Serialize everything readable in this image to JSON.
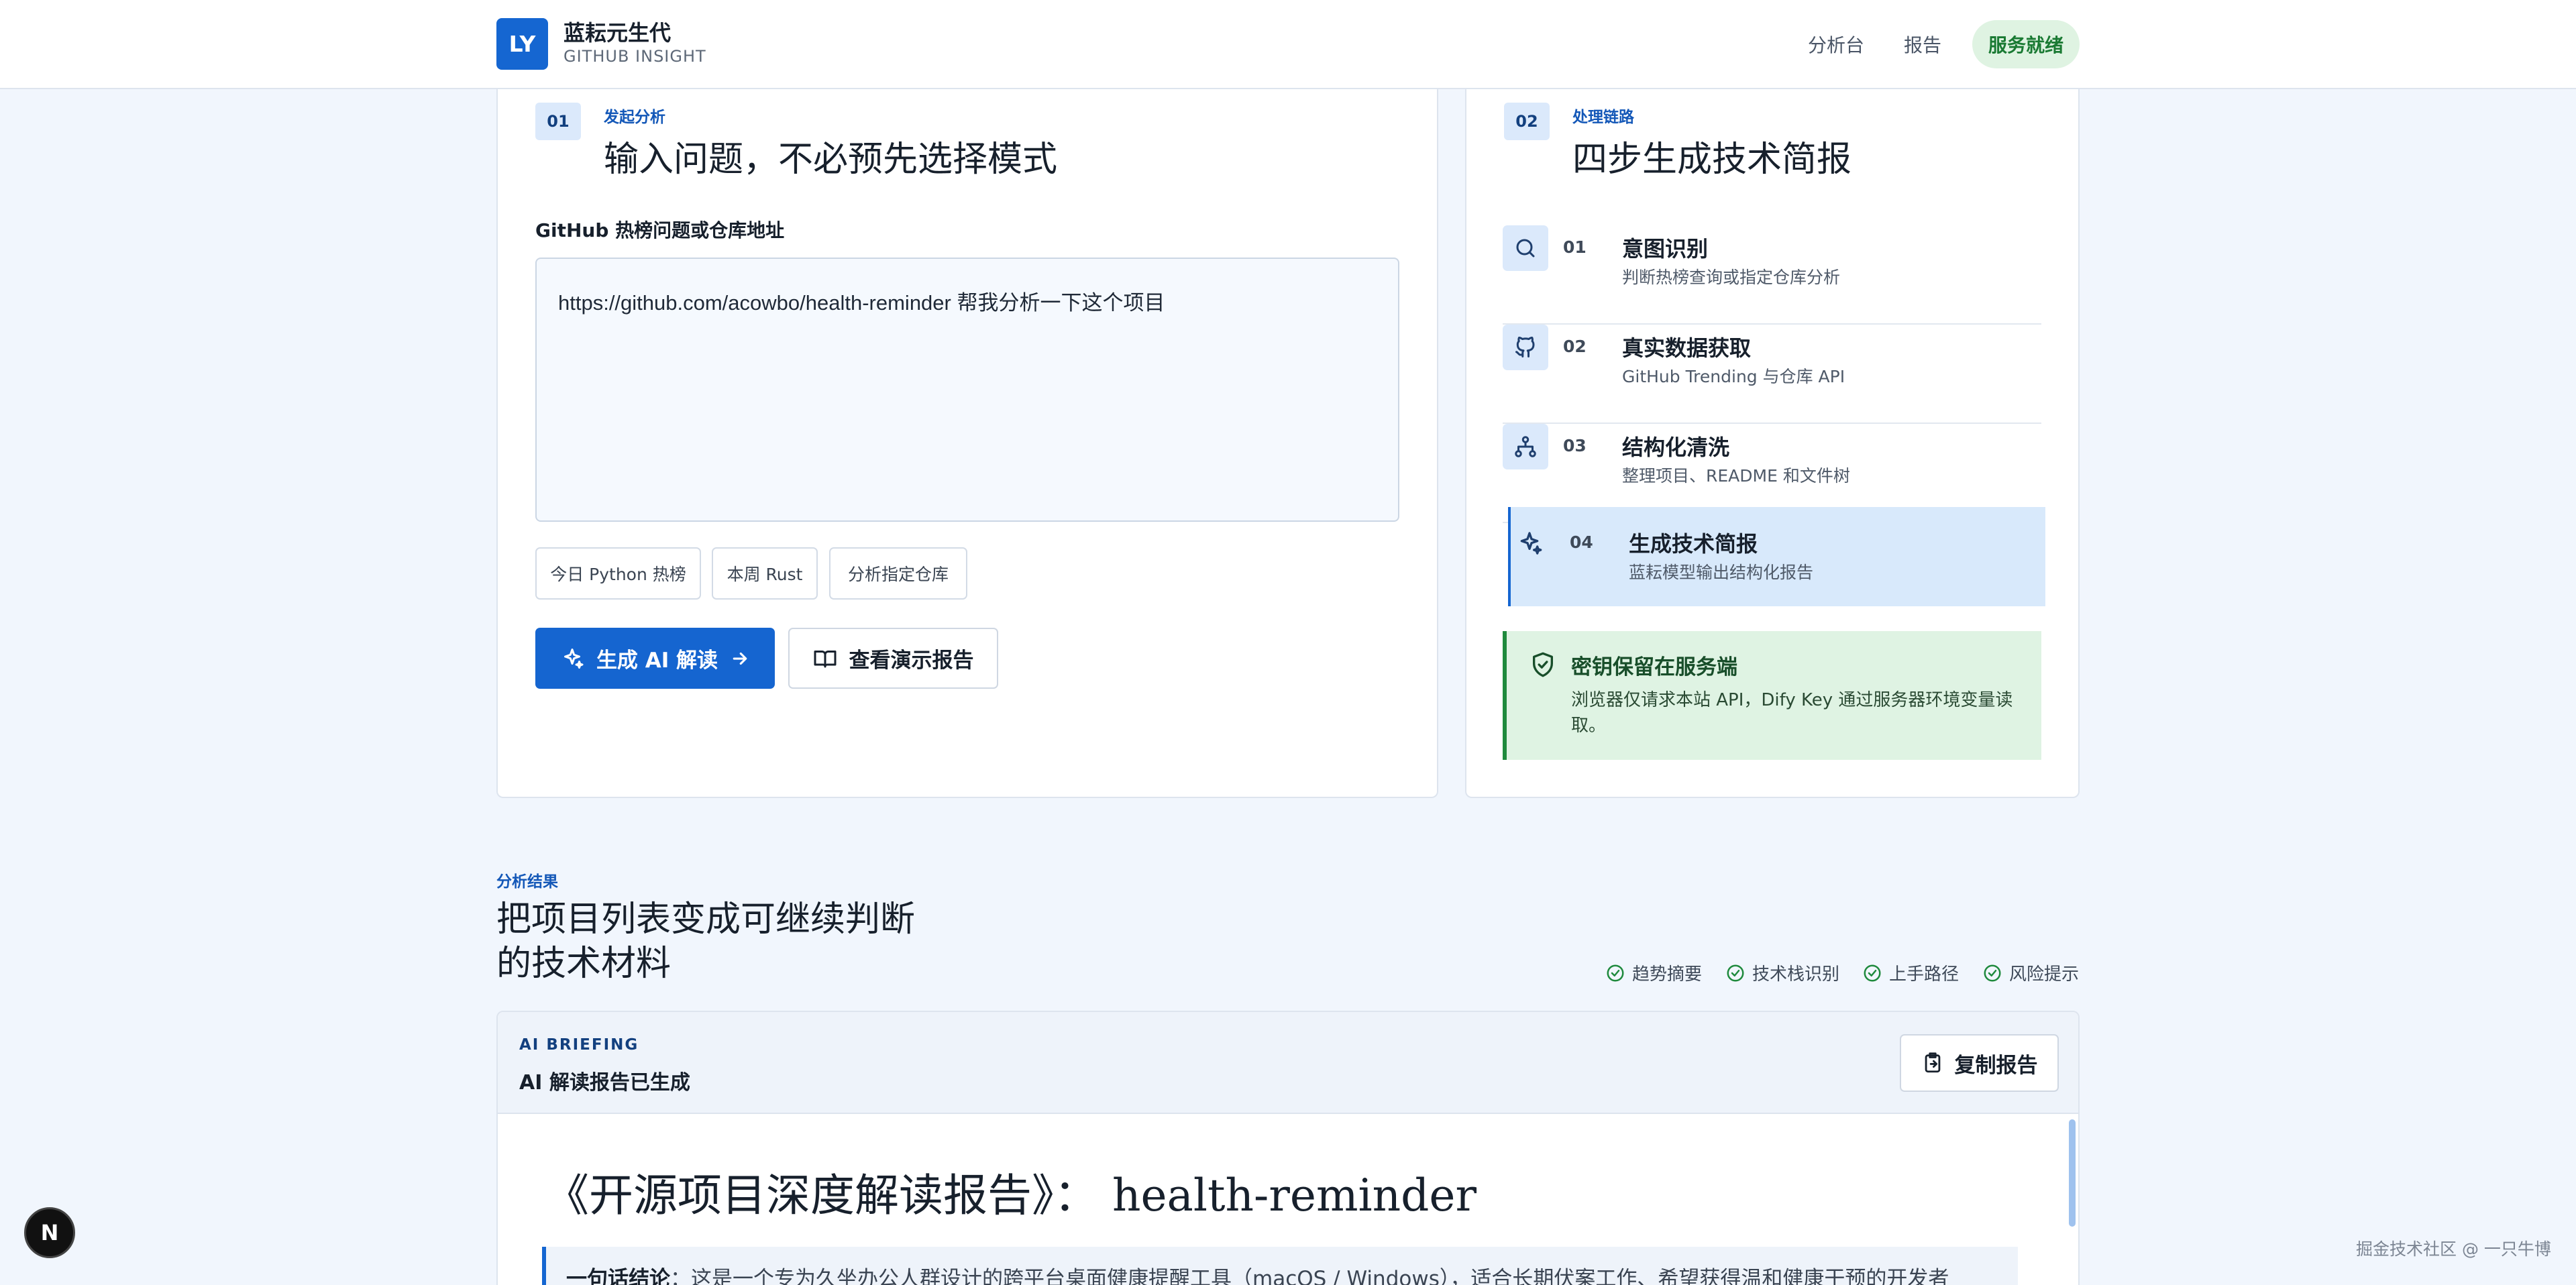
{
  "header": {
    "logo_text": "LY",
    "brand_name": "蓝耘元生代",
    "brand_sub": "GITHUB INSIGHT",
    "nav": [
      "分析台",
      "报告"
    ],
    "status": "服务就绪"
  },
  "input_card": {
    "step": "01",
    "eyebrow": "发起分析",
    "title": "输入问题，不必预先选择模式",
    "field_label": "GitHub 热榜问题或仓库地址",
    "input_value": "https://github.com/acowbo/health-reminder 帮我分析一下这个项目",
    "chips": [
      "今日 Python 热榜",
      "本周 Rust",
      "分析指定仓库"
    ],
    "primary_button": "生成 AI 解读",
    "secondary_button": "查看演示报告"
  },
  "pipeline_card": {
    "step": "02",
    "eyebrow": "处理链路",
    "title": "四步生成技术简报",
    "steps": [
      {
        "num": "01",
        "title": "意图识别",
        "desc": "判断热榜查询或指定仓库分析",
        "icon": "search-icon"
      },
      {
        "num": "02",
        "title": "真实数据获取",
        "desc": "GitHub Trending 与仓库 API",
        "icon": "github-icon"
      },
      {
        "num": "03",
        "title": "结构化清洗",
        "desc": "整理项目、README 和文件树",
        "icon": "sitemap-icon"
      },
      {
        "num": "04",
        "title": "生成技术简报",
        "desc": "蓝耘模型输出结构化报告",
        "icon": "sparkles-icon"
      }
    ],
    "notice_title": "密钥保留在服务端",
    "notice_body": "浏览器仅请求本站 API，Dify Key 通过服务器环境变量读取。"
  },
  "results": {
    "eyebrow": "分析结果",
    "title": "把项目列表变成可继续判断的技术材料",
    "tags": [
      "趋势摘要",
      "技术栈识别",
      "上手路径",
      "风险提示"
    ]
  },
  "report": {
    "eyebrow": "AI BRIEFING",
    "status": "AI 解读报告已生成",
    "copy_button": "复制报告",
    "doc_title": "《开源项目深度解读报告》： health-reminder",
    "summary_label": "一句话结论",
    "summary_text": "：这是一个专为久坐办公人群设计的跨平台桌面健康提醒工具（macOS / Windows），适合长期伏案工作、希望获得温和健康干预的开发者"
  },
  "misc": {
    "badge": "N",
    "watermark": "掘金技术社区 @ 一只牛博"
  }
}
